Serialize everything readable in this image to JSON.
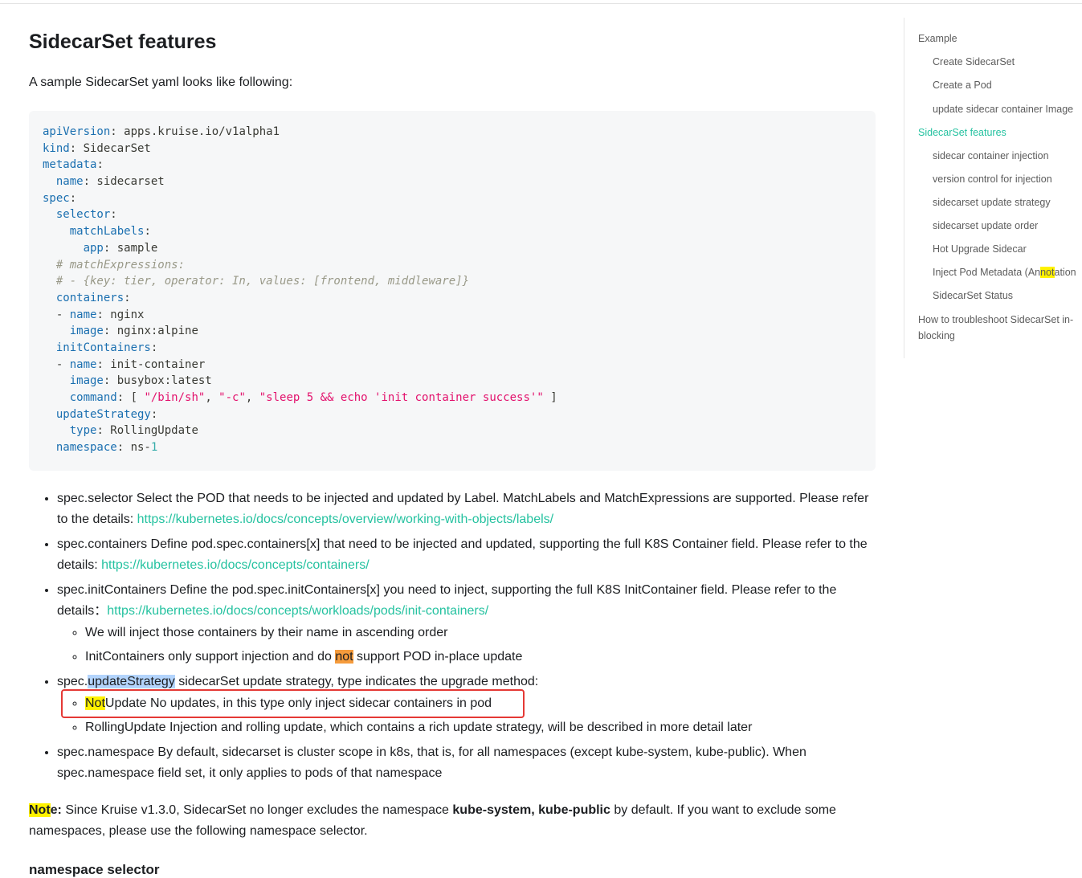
{
  "page": {
    "title": "SidecarSet features",
    "intro": "A sample SidecarSet yaml looks like following:"
  },
  "code_lines": [
    [
      {
        "t": "apiVersion",
        "c": "k"
      },
      {
        "t": ": apps.kruise.io/v1alpha1"
      }
    ],
    [
      {
        "t": "kind",
        "c": "k"
      },
      {
        "t": ": SidecarSet"
      }
    ],
    [
      {
        "t": "metadata",
        "c": "k"
      },
      {
        "t": ":"
      }
    ],
    [
      {
        "t": "  "
      },
      {
        "t": "name",
        "c": "k"
      },
      {
        "t": ": sidecarset"
      }
    ],
    [
      {
        "t": "spec",
        "c": "k"
      },
      {
        "t": ":"
      }
    ],
    [
      {
        "t": "  "
      },
      {
        "t": "selector",
        "c": "k"
      },
      {
        "t": ":"
      }
    ],
    [
      {
        "t": "    "
      },
      {
        "t": "matchLabels",
        "c": "k"
      },
      {
        "t": ":"
      }
    ],
    [
      {
        "t": "      "
      },
      {
        "t": "app",
        "c": "k"
      },
      {
        "t": ": sample"
      }
    ],
    [
      {
        "t": "  "
      },
      {
        "t": "# matchExpressions:",
        "c": "c"
      }
    ],
    [
      {
        "t": "  "
      },
      {
        "t": "# - {key: tier, operator: In, values: [frontend, middleware]}",
        "c": "c"
      }
    ],
    [
      {
        "t": "  "
      },
      {
        "t": "containers",
        "c": "k"
      },
      {
        "t": ":"
      }
    ],
    [
      {
        "t": "  - "
      },
      {
        "t": "name",
        "c": "k"
      },
      {
        "t": ": nginx"
      }
    ],
    [
      {
        "t": "    "
      },
      {
        "t": "image",
        "c": "k"
      },
      {
        "t": ": nginx:alpine"
      }
    ],
    [
      {
        "t": "  "
      },
      {
        "t": "initContainers",
        "c": "k"
      },
      {
        "t": ":"
      }
    ],
    [
      {
        "t": "  - "
      },
      {
        "t": "name",
        "c": "k"
      },
      {
        "t": ": init-container"
      }
    ],
    [
      {
        "t": "    "
      },
      {
        "t": "image",
        "c": "k"
      },
      {
        "t": ": busybox:latest"
      }
    ],
    [
      {
        "t": "    "
      },
      {
        "t": "command",
        "c": "k"
      },
      {
        "t": ": [ "
      },
      {
        "t": "\"/bin/sh\"",
        "c": "s"
      },
      {
        "t": ", "
      },
      {
        "t": "\"-c\"",
        "c": "s"
      },
      {
        "t": ", "
      },
      {
        "t": "\"sleep 5 && echo 'init container success'\"",
        "c": "s"
      },
      {
        "t": " ]"
      }
    ],
    [
      {
        "t": "  "
      },
      {
        "t": "updateStrategy",
        "c": "k"
      },
      {
        "t": ":"
      }
    ],
    [
      {
        "t": "    "
      },
      {
        "t": "type",
        "c": "k"
      },
      {
        "t": ": RollingUpdate"
      }
    ],
    [
      {
        "t": "  "
      },
      {
        "t": "namespace",
        "c": "k"
      },
      {
        "t": ": ns-"
      },
      {
        "t": "1",
        "c": "n"
      }
    ]
  ],
  "bullets": {
    "b1": {
      "text": "spec.selector Select the POD that needs to be injected and updated by Label. MatchLabels and MatchExpressions are supported. Please refer to the details: ",
      "link": "https://kubernetes.io/docs/concepts/overview/working-with-objects/labels/"
    },
    "b2": {
      "text": "spec.containers Define pod.spec.containers[x] that need to be injected and updated, supporting the full K8S Container field. Please refer to the details: ",
      "link": "https://kubernetes.io/docs/concepts/containers/"
    },
    "b3": {
      "text": "spec.initContainers Define the pod.spec.initContainers[x] you need to inject, supporting the full K8S InitContainer field. Please refer to the details：",
      "link": "https://kubernetes.io/docs/concepts/workloads/pods/init-containers/",
      "sub1": "We will inject those containers by their name in ascending order",
      "sub2_pre": "InitContainers only support injection and do ",
      "sub2_hl": "not",
      "sub2_post": " support POD in-place update"
    },
    "b4": {
      "pre": "spec.",
      "sel": "updateStrategy",
      "post": " sidecarSet update strategy, type indicates the upgrade method:",
      "sub1_hl": "Not",
      "sub1_post": "Update No updates, in this type only inject sidecar containers in pod",
      "sub2": "RollingUpdate Injection and rolling update, which contains a rich update strategy, will be described in more detail later"
    },
    "b5": {
      "text": "spec.namespace By default, sidecarset is cluster scope in k8s, that is, for all namespaces (except kube-system, kube-public). When spec.namespace field set, it only applies to pods of that namespace"
    }
  },
  "note": {
    "hl": "Not",
    "label_rest": "e:",
    "text1": " Since Kruise v1.3.0, SidecarSet no longer excludes the namespace ",
    "bold": "kube-system, kube-public",
    "text2": " by default. If you want to exclude some namespaces, please use the following namespace selector."
  },
  "next_heading": "namespace selector",
  "toc": {
    "example": "Example",
    "create_sidecarset": "Create SidecarSet",
    "create_pod": "Create a Pod",
    "update_image": "update sidecar container Image",
    "features": "SidecarSet features",
    "injection": "sidecar container injection",
    "version_control": "version control for injection",
    "update_strategy": "sidecarset update strategy",
    "update_order": "sidecarset update order",
    "hot_upgrade": "Hot Upgrade Sidecar",
    "inject_meta_pre": "Inject Pod Metadata (An",
    "inject_meta_hl": "not",
    "inject_meta_post": "ation",
    "status": "SidecarSet Status",
    "troubleshoot": "How to troubleshoot SidecarSet in-blocking"
  },
  "colors": {
    "accent": "#25c2a0",
    "highlight_yellow": "#fff200",
    "highlight_orange": "#f59b3c",
    "annotation_box": "#e53935"
  }
}
